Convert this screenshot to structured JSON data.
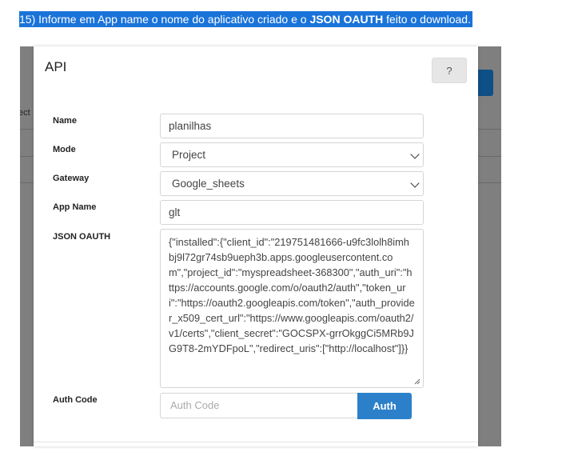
{
  "instruction": {
    "prefix": "15) Informe em App name o nome do aplicativo criado e o ",
    "bold": "JSON OAUTH",
    "suffix": " feito o download."
  },
  "background": {
    "partial_text": "ect"
  },
  "modal": {
    "title": "API",
    "help_label": "?",
    "fields": {
      "name": {
        "label": "Name",
        "value": "planilhas"
      },
      "mode": {
        "label": "Mode",
        "value": "Project"
      },
      "gateway": {
        "label": "Gateway",
        "value": "Google_sheets"
      },
      "app_name": {
        "label": "App Name",
        "value": "glt"
      },
      "json_oauth": {
        "label": "JSON OAUTH",
        "value": "{\"installed\":{\"client_id\":\"219751481666-u9fc3lolh8imhbj9l72gr74sb9ueph3b.apps.googleusercontent.com\",\"project_id\":\"myspreadsheet-368300\",\"auth_uri\":\"https://accounts.google.com/o/oauth2/auth\",\"token_uri\":\"https://oauth2.googleapis.com/token\",\"auth_provider_x509_cert_url\":\"https://www.googleapis.com/oauth2/v1/certs\",\"client_secret\":\"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\",\"redirect_uris\":[\"http://localhost\"]}}"
      },
      "auth_code": {
        "label": "Auth Code",
        "placeholder": "Auth Code",
        "button_label": "Auth"
      }
    }
  },
  "colors": {
    "instruction_highlight": "#1a73d9",
    "auth_button": "#2c80c9",
    "overlay": "#7f7f7f"
  }
}
